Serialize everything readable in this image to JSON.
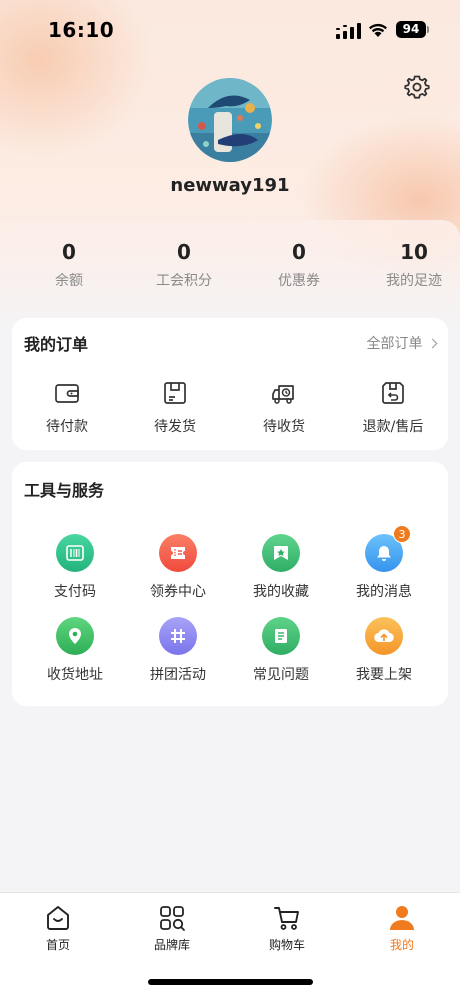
{
  "status_bar": {
    "time": "16:10",
    "battery": "94"
  },
  "profile": {
    "username": "newway191"
  },
  "stats": [
    {
      "value": "0",
      "label": "余额"
    },
    {
      "value": "0",
      "label": "工会积分"
    },
    {
      "value": "0",
      "label": "优惠券"
    },
    {
      "value": "10",
      "label": "我的足迹"
    }
  ],
  "orders": {
    "title": "我的订单",
    "all_label": "全部订单",
    "items": [
      {
        "label": "待付款",
        "icon": "wallet-icon"
      },
      {
        "label": "待发货",
        "icon": "box-icon"
      },
      {
        "label": "待收货",
        "icon": "delivery-truck-icon"
      },
      {
        "label": "退款/售后",
        "icon": "return-box-icon"
      }
    ]
  },
  "services": {
    "title": "工具与服务",
    "items": [
      {
        "label": "支付码",
        "icon": "barcode-icon",
        "color": "#2cc08a"
      },
      {
        "label": "领券中心",
        "icon": "coupon-icon",
        "color": "#f4614e"
      },
      {
        "label": "我的收藏",
        "icon": "favorite-icon",
        "color": "#3cc07a"
      },
      {
        "label": "我的消息",
        "icon": "bell-icon",
        "color": "#45a8f5",
        "badge": "3"
      },
      {
        "label": "收货地址",
        "icon": "location-pin-icon",
        "color": "#44bd6a"
      },
      {
        "label": "拼团活动",
        "icon": "grid-hash-icon",
        "color": "#8a86f0"
      },
      {
        "label": "常见问题",
        "icon": "document-icon",
        "color": "#3fbd6e"
      },
      {
        "label": "我要上架",
        "icon": "upload-cloud-icon",
        "color": "#f7a93a"
      }
    ]
  },
  "tabbar": {
    "active_color": "#f07a1e",
    "tabs": [
      {
        "label": "首页",
        "icon": "home-icon"
      },
      {
        "label": "品牌库",
        "icon": "brand-grid-icon"
      },
      {
        "label": "购物车",
        "icon": "cart-icon"
      },
      {
        "label": "我的",
        "icon": "user-icon",
        "active": true
      }
    ]
  }
}
